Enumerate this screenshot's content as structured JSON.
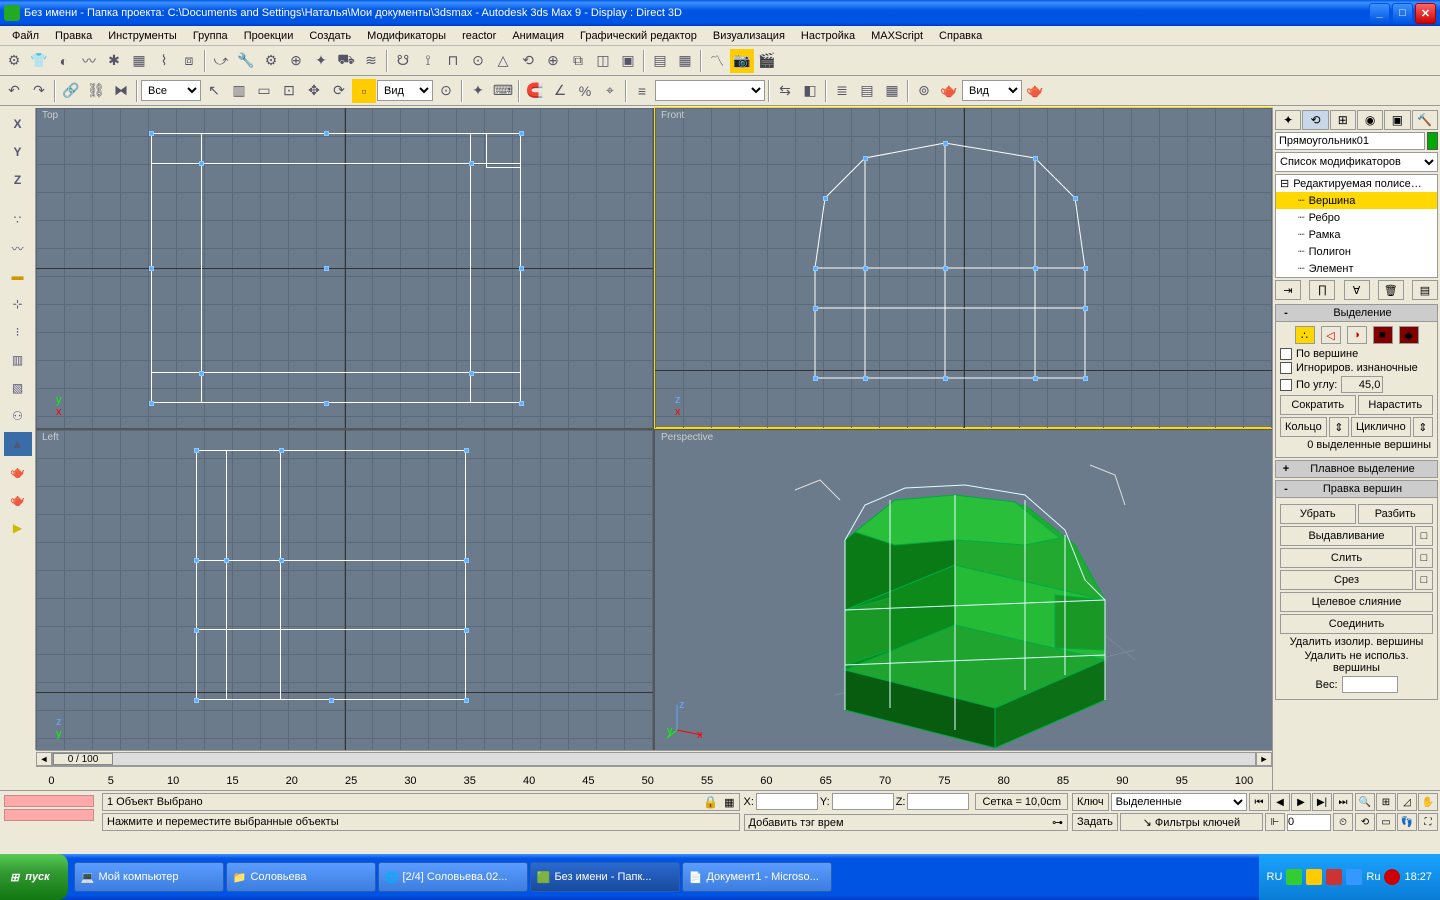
{
  "titlebar": {
    "text": "Без имени      - Папка проекта: C:\\Documents and Settings\\Наталья\\Мои документы\\3dsmax        - Autodesk 3ds Max 9        - Display : Direct 3D"
  },
  "menu": [
    "Файл",
    "Правка",
    "Инструменты",
    "Группа",
    "Проекции",
    "Создать",
    "Модификаторы",
    "reactor",
    "Анимация",
    "Графический редактор",
    "Визуализация",
    "Настройка",
    "MAXScript",
    "Справка"
  ],
  "toolbar2": {
    "dropdown1": "Все",
    "dropdown2": "Вид",
    "dropdown3": "Вид"
  },
  "viewports": {
    "top": "Top",
    "front": "Front",
    "left": "Left",
    "persp": "Perspective"
  },
  "left_letters": [
    "X",
    "Y",
    "Z"
  ],
  "right_panel": {
    "object_name": "Прямоугольник01",
    "modifier_list_placeholder": "Список модификаторов",
    "stack_root": "Редактируемая полисе…",
    "stack_items": [
      "Вершина",
      "Ребро",
      "Рамка",
      "Полигон",
      "Элемент"
    ],
    "rollout_selection": "Выделение",
    "chk_by_vertex": "По вершине",
    "chk_ignore_back": "Игнориров. изнаночные",
    "chk_by_angle": "По углу:",
    "angle_val": "45,0",
    "btn_shrink": "Сократить",
    "btn_grow": "Нарастить",
    "btn_ring": "Кольцо",
    "btn_loop": "Циклично",
    "sel_status": "0 выделенные вершины",
    "rollout_soft": "Плавное выделение",
    "rollout_editv": "Правка вершин",
    "btn_remove": "Убрать",
    "btn_break": "Разбить",
    "btn_extrude": "Выдавливание",
    "btn_weld": "Слить",
    "btn_chamfer": "Срез",
    "btn_target": "Целевое слияние",
    "btn_connect": "Соединить",
    "btn_rem_iso": "Удалить изолир. вершины",
    "btn_rem_unused": "Удалить не использ. вершины",
    "weight_lbl": "Вес:"
  },
  "timeline": {
    "frame_label": "0 / 100",
    "ticks": [
      "0",
      "5",
      "10",
      "15",
      "20",
      "25",
      "30",
      "35",
      "40",
      "45",
      "50",
      "55",
      "60",
      "65",
      "70",
      "75",
      "80",
      "85",
      "90",
      "95",
      "100"
    ]
  },
  "status": {
    "line1": "1 Объект Выбрано",
    "hint": "Нажмите и переместите выбранные объекты",
    "x": "X:",
    "y": "Y:",
    "z": "Z:",
    "grid": "Сетка = 10,0cm",
    "tag": "Добавить тэг врем",
    "key_btn": "Ключ",
    "set_btn": "Задать",
    "sel_mode": "Выделенные",
    "key_filters": "Фильтры ключей",
    "frame_val": "0"
  },
  "taskbar": {
    "start": "пуск",
    "tasks": [
      "Мой компьютер",
      "Соловьева",
      "[2/4] Соловьева.02...",
      "Без имени      - Папк...",
      "Документ1 - Microso..."
    ],
    "lang": "RU",
    "lang2": "Ru",
    "time": "18:27"
  }
}
